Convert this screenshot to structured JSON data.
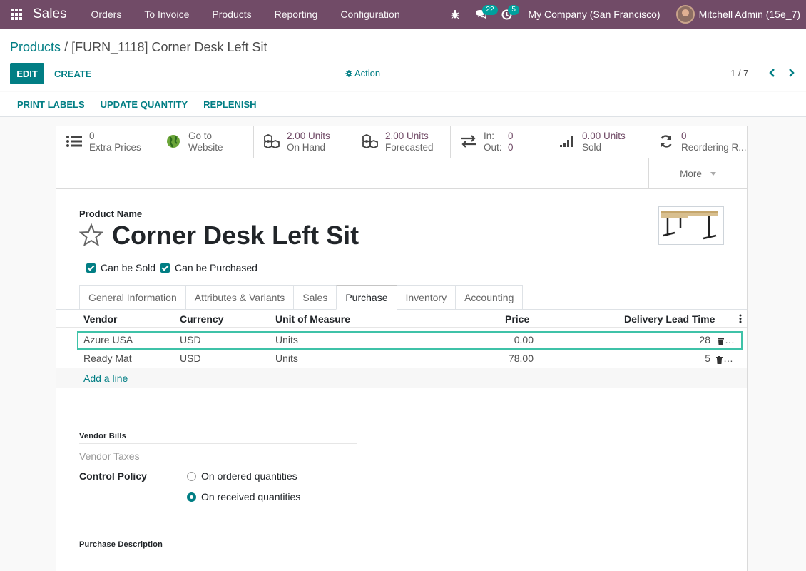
{
  "navbar": {
    "app_name": "Sales",
    "menu": [
      "Orders",
      "To Invoice",
      "Products",
      "Reporting",
      "Configuration"
    ],
    "messages_count": "22",
    "activities_count": "5",
    "company": "My Company (San Francisco)",
    "user": "Mitchell Admin (15e_7)"
  },
  "breadcrumb": {
    "parent": "Products",
    "separator": "/",
    "current": "[FURN_1118] Corner Desk Left Sit"
  },
  "buttons": {
    "edit": "EDIT",
    "create": "CREATE",
    "action": "Action"
  },
  "pager": {
    "value": "1 / 7"
  },
  "header_buttons": [
    "PRINT LABELS",
    "UPDATE QUANTITY",
    "REPLENISH"
  ],
  "stat_buttons": [
    {
      "value": "0",
      "label": "Extra Prices",
      "icon": "list-icon"
    },
    {
      "value": "Go to",
      "label": "Website",
      "icon": "globe-icon"
    },
    {
      "value": "2.00 Units",
      "label": "On Hand",
      "icon": "cubes-icon"
    },
    {
      "value": "2.00 Units",
      "label": "Forecasted",
      "icon": "cubes-icon"
    },
    {
      "in_label": "In:",
      "in_value": "0",
      "out_label": "Out:",
      "out_value": "0",
      "icon": "exchange-icon"
    },
    {
      "value": "0.00 Units",
      "label": "Sold",
      "icon": "signal-icon"
    },
    {
      "value": "0",
      "label": "Reordering R...",
      "icon": "refresh-icon"
    }
  ],
  "more": "More",
  "product": {
    "name_label": "Product Name",
    "name": "Corner Desk Left Sit",
    "can_be_sold": "Can be Sold",
    "can_be_purchased": "Can be Purchased"
  },
  "tabs": [
    "General Information",
    "Attributes & Variants",
    "Sales",
    "Purchase",
    "Inventory",
    "Accounting"
  ],
  "active_tab": "Purchase",
  "vendor_table": {
    "headers": [
      "Vendor",
      "Currency",
      "Unit of Measure",
      "Price",
      "Delivery Lead Time"
    ],
    "rows": [
      {
        "vendor": "Azure USA",
        "currency": "USD",
        "uom": "Units",
        "price": "0.00",
        "lead": "28"
      },
      {
        "vendor": "Ready Mat",
        "currency": "USD",
        "uom": "Units",
        "price": "78.00",
        "lead": "5"
      }
    ],
    "add_line": "Add a line"
  },
  "vendor_bills": {
    "section": "Vendor Bills",
    "vendor_taxes": "Vendor Taxes",
    "control_policy_label": "Control Policy",
    "options": [
      "On ordered quantities",
      "On received quantities"
    ],
    "selected": "On received quantities"
  },
  "purchase_description": "Purchase Description",
  "colors": {
    "navbar": "#714b67",
    "primary": "#017e84",
    "selected_row_border": "#3fc2a8"
  }
}
